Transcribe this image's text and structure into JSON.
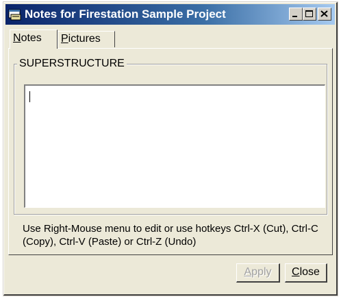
{
  "window": {
    "title": "Notes for Firestation Sample Project",
    "colors": {
      "titlebar_start": "#0a246a",
      "titlebar_end": "#a6caf0",
      "face": "#ece9d8"
    }
  },
  "tabs": [
    {
      "label_underlined": "N",
      "label_rest": "otes",
      "selected": true
    },
    {
      "label_underlined": "P",
      "label_rest": "ictures",
      "selected": false
    }
  ],
  "group": {
    "label": "SUPERSTRUCTURE"
  },
  "editor": {
    "value": ""
  },
  "hint": {
    "text": "Use Right-Mouse menu to edit or use hotkeys Ctrl-X (Cut), Ctrl-C (Copy), Ctrl-V (Paste) or Ctrl-Z (Undo)"
  },
  "buttons": {
    "apply": {
      "label_underlined": "A",
      "label_rest": "pply",
      "enabled": false
    },
    "close": {
      "label_underlined": "C",
      "label_rest": "lose",
      "enabled": true
    }
  }
}
